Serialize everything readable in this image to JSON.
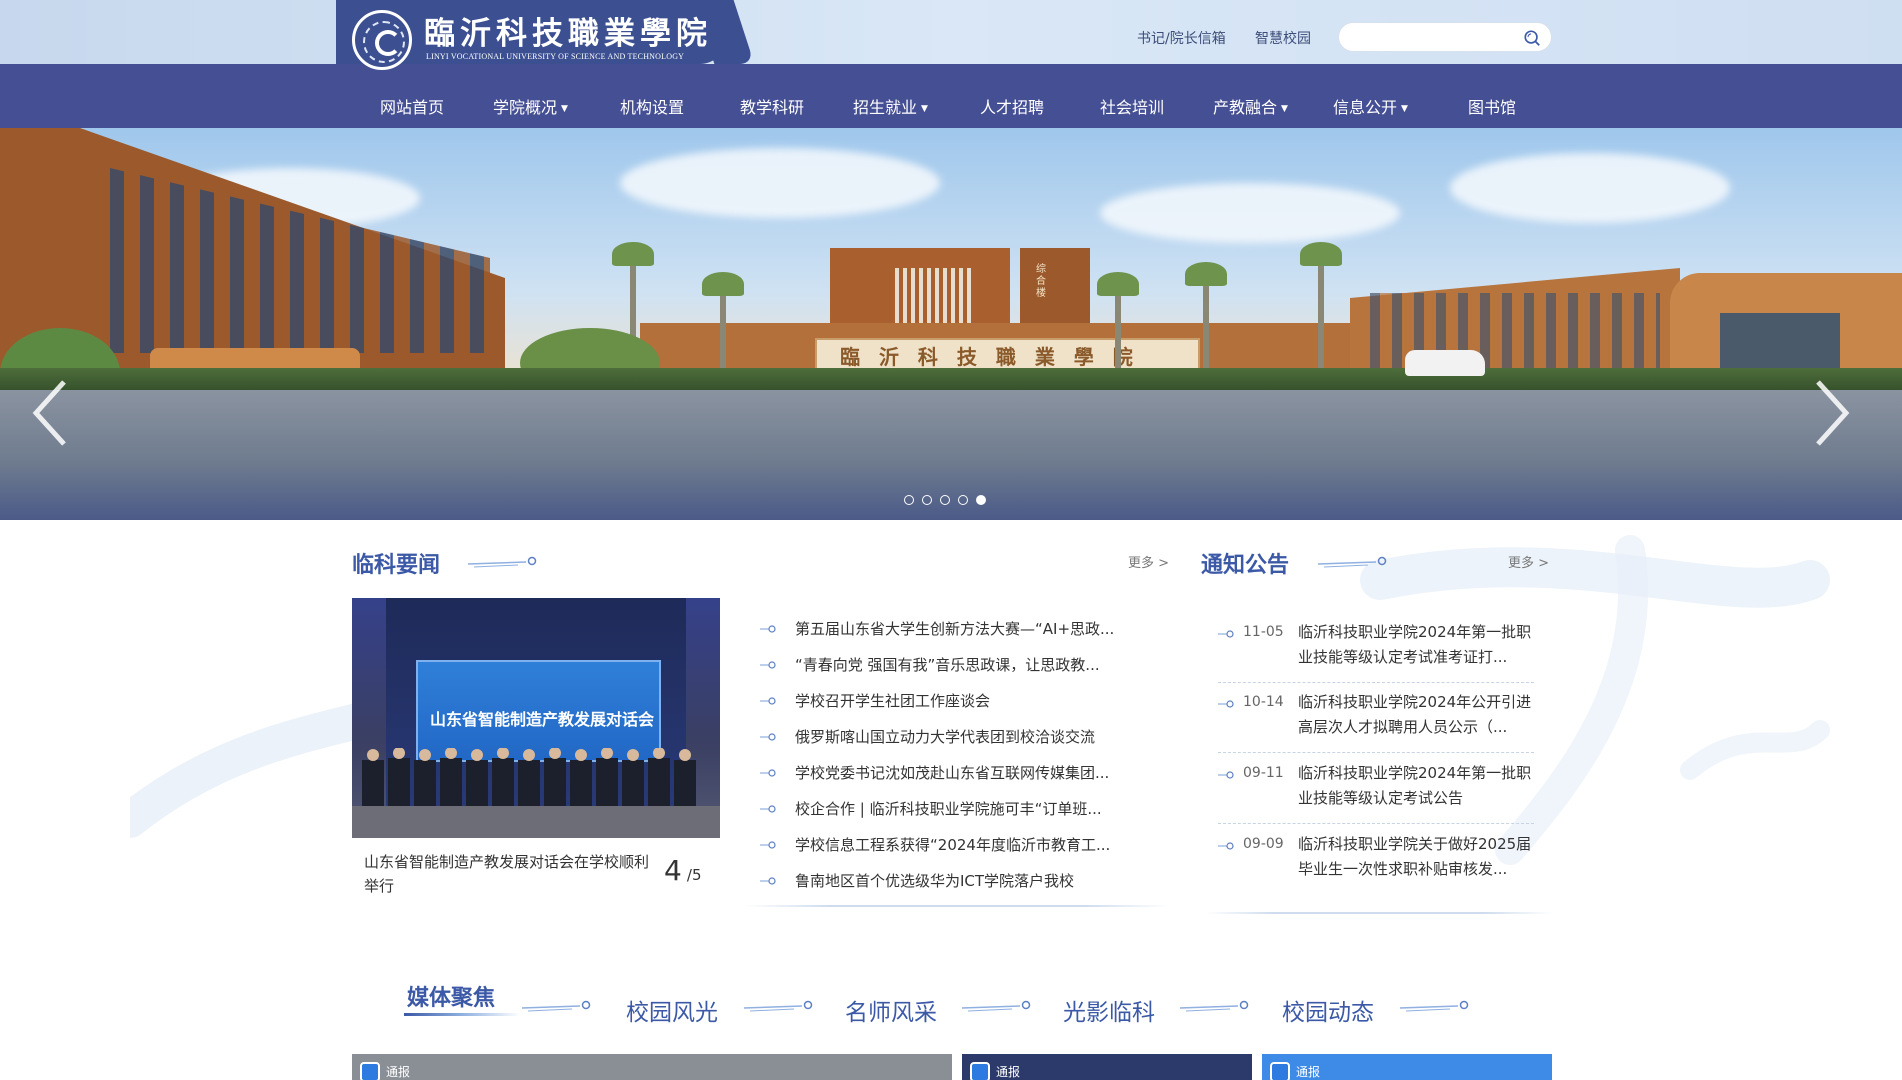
{
  "header": {
    "logo_cn": "臨沂科技職業學院",
    "logo_en": "LINYI VOCATIONAL UNIVERSITY OF SCIENCE AND TECHNOLOGY",
    "links": [
      "书记/院长信箱",
      "智慧校园"
    ],
    "search_placeholder": "",
    "colors": {
      "nav_bg": "#454f94",
      "logo_bg": "#3b4f91",
      "accent": "#3b59a6"
    }
  },
  "nav": {
    "items": [
      {
        "label": "网站首页",
        "dropdown": false
      },
      {
        "label": "学院概况",
        "dropdown": true
      },
      {
        "label": "机构设置",
        "dropdown": false
      },
      {
        "label": "教学科研",
        "dropdown": false
      },
      {
        "label": "招生就业",
        "dropdown": true
      },
      {
        "label": "人才招聘",
        "dropdown": false
      },
      {
        "label": "社会培训",
        "dropdown": false
      },
      {
        "label": "产教融合",
        "dropdown": true
      },
      {
        "label": "信息公开",
        "dropdown": true
      },
      {
        "label": "图书馆",
        "dropdown": false
      }
    ],
    "caret": "▼"
  },
  "banner": {
    "gate_text": "臨 沂 科 技 職 業 學 院",
    "building_sign": "综合楼",
    "slide_count": 5,
    "active_slide": 5
  },
  "news": {
    "title": "临科要闻",
    "more": "更多 >",
    "feature": {
      "screen_title": "山东省智能制造产教发展对话会",
      "caption": "山东省智能制造产教发展对话会在学校顺利举行",
      "current": "4",
      "total": "/5"
    },
    "items": [
      "第五届山东省大学生创新方法大赛—“AI+思政...",
      "“青春向党 强国有我”音乐思政课，让思政教...",
      "学校召开学生社团工作座谈会",
      "俄罗斯喀山国立动力大学代表团到校洽谈交流",
      "学校党委书记沈如茂赴山东省互联网传媒集团...",
      "校企合作 | 临沂科技职业学院施可丰“订单班...",
      "学校信息工程系获得“2024年度临沂市教育工...",
      "鲁南地区首个优选级华为ICT学院落户我校"
    ]
  },
  "notices": {
    "title": "通知公告",
    "more": "更多 >",
    "items": [
      {
        "date": "11-05",
        "title": "临沂科技职业学院2024年第一批职业技能等级认定考试准考证打..."
      },
      {
        "date": "10-14",
        "title": "临沂科技职业学院2024年公开引进高层次人才拟聘用人员公示（..."
      },
      {
        "date": "09-11",
        "title": "临沂科技职业学院2024年第一批职业技能等级认定考试公告"
      },
      {
        "date": "09-09",
        "title": "临沂科技职业学院关于做好2025届毕业生一次性求职补贴审核发..."
      }
    ]
  },
  "media_tabs": {
    "items": [
      "媒体聚焦",
      "校园风光",
      "名师风采",
      "光影临科",
      "校园动态"
    ],
    "active": 0
  },
  "thumbnails": [
    {
      "label": "通报"
    },
    {
      "label": "通报"
    },
    {
      "label": "通报"
    }
  ]
}
